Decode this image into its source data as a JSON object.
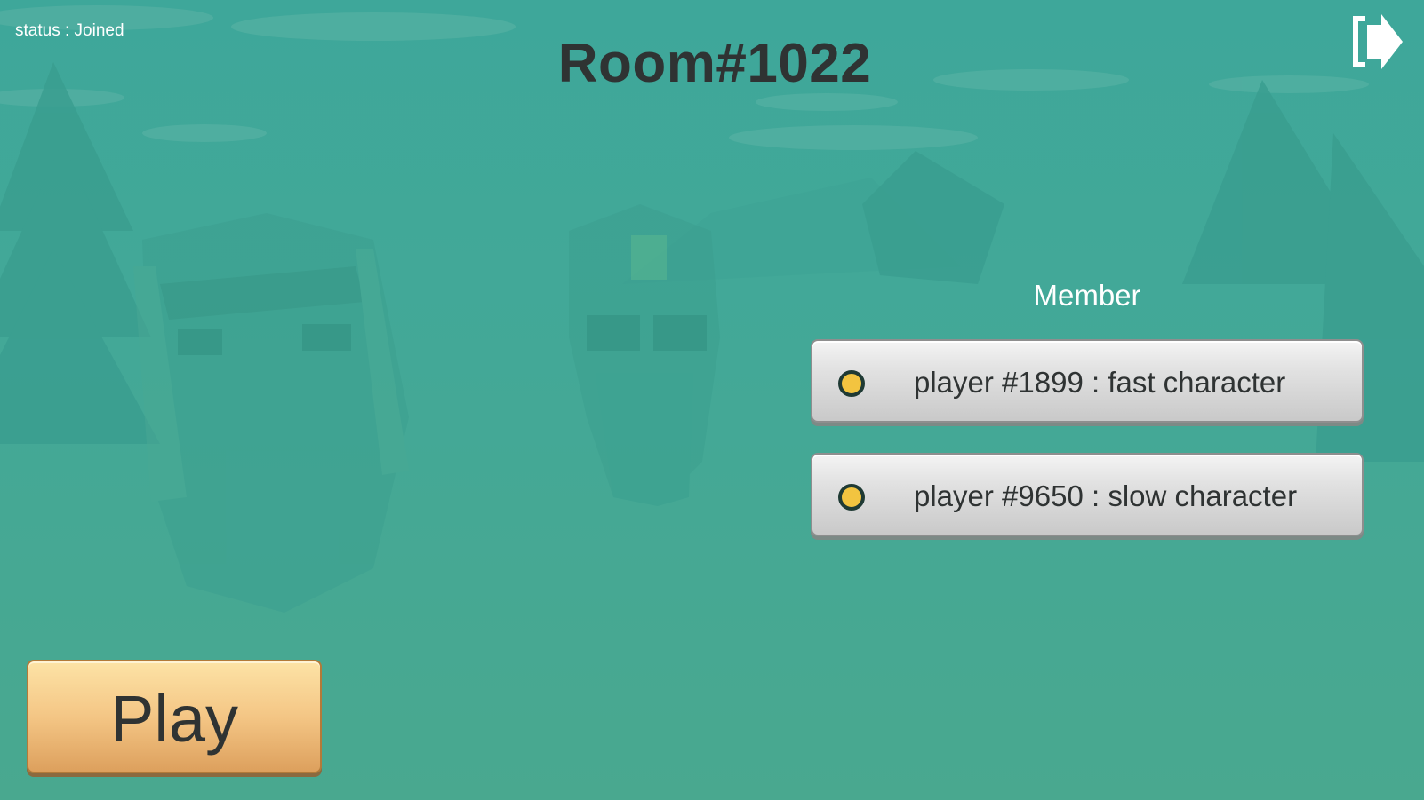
{
  "status": {
    "label": "status : Joined"
  },
  "room": {
    "title": "Room#1022"
  },
  "exit": {
    "icon": "exit-door-icon"
  },
  "members": {
    "heading": "Member",
    "list": [
      {
        "text": "player #1899 : fast character",
        "ready_color": "#f2c440"
      },
      {
        "text": "player #9650 : slow character",
        "ready_color": "#f2c440"
      }
    ]
  },
  "play": {
    "label": "Play"
  },
  "colors": {
    "background": "#43a897",
    "title_text": "#2f3333",
    "member_row": "#dcdcdc",
    "play_button": "#f4c685",
    "ready_dot": "#f2c440"
  }
}
